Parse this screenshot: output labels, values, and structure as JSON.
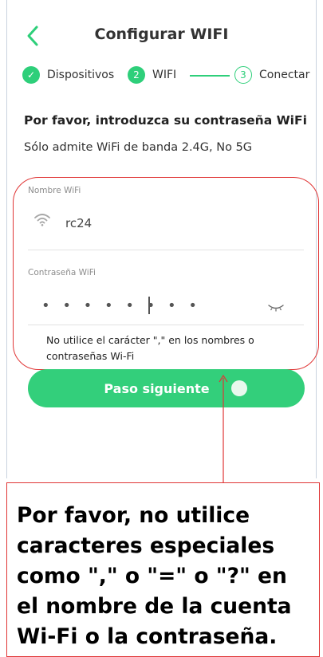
{
  "header": {
    "title": "Configurar WIFI",
    "back_icon": "chevron-left-icon"
  },
  "steps": [
    {
      "label": "Dispositivos",
      "state": "done",
      "marker": "✓"
    },
    {
      "label": "WIFI",
      "state": "active",
      "marker": "2"
    },
    {
      "label": "Conectar",
      "state": "todo",
      "marker": "3"
    }
  ],
  "intro": {
    "heading": "Por favor, introduzca su contraseña WiFi",
    "subheading": "Sólo admite WiFi de banda 2.4G, No 5G"
  },
  "form": {
    "ssid_label": "Nombre WiFi",
    "ssid_value": "rc24",
    "password_label": "Contraseña WiFi",
    "password_value": "• • • • • • • •",
    "hint": "No utilice el carácter \",\" en los nombres o contraseñas Wi-Fi"
  },
  "next_button": {
    "label": "Paso siguiente"
  },
  "callout": {
    "text": "Por favor, no utilice caracteres especiales como \",\" o \"=\" o \"?\" en el nombre de la cuenta Wi-Fi o la contraseña."
  },
  "colors": {
    "accent": "#33cf7b",
    "annotation": "#e03636"
  }
}
